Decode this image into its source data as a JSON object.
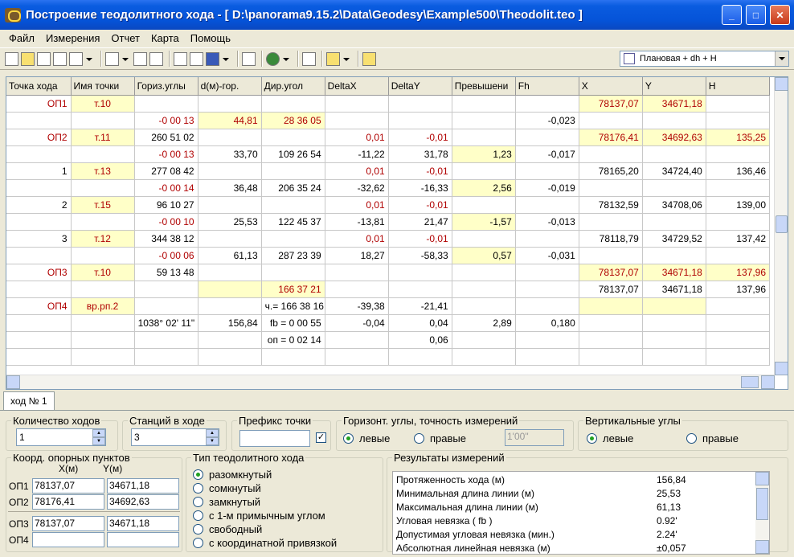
{
  "window": {
    "title": "Построение теодолитного хода - [ D:\\panorama9.15.2\\Data\\Geodesy\\Example500\\Theodolit.teo ]"
  },
  "menu": [
    "Файл",
    "Измерения",
    "Отчет",
    "Карта",
    "Помощь"
  ],
  "toolbar": {
    "mode_value": "Плановая + dh + H"
  },
  "grid": {
    "columns": [
      "Точка хода",
      "Имя точки",
      "Гориз.углы",
      "d(м)-гор.",
      "Дир.угол",
      "DeltaX",
      "DeltaY",
      "Превышени",
      "Fh",
      "X",
      "Y",
      "H"
    ],
    "rows": [
      [
        "ОП1",
        "т.10",
        "",
        "",
        "",
        "",
        "",
        "",
        "",
        "78137,07",
        "34671,18",
        ""
      ],
      [
        "",
        "",
        "-0 00 13",
        "44,81",
        "28 36 05",
        "",
        "",
        "",
        "-0,023",
        "",
        "",
        ""
      ],
      [
        "ОП2",
        "т.11",
        "260 51 02",
        "",
        "",
        "0,01",
        "-0,01",
        "",
        "",
        "78176,41",
        "34692,63",
        "135,25"
      ],
      [
        "",
        "",
        "-0 00 13",
        "33,70",
        "109 26 54",
        "-11,22",
        "31,78",
        "1,23",
        "-0,017",
        "",
        "",
        ""
      ],
      [
        "1",
        "т.13",
        "277 08 42",
        "",
        "",
        "0,01",
        "-0,01",
        "",
        "",
        "78165,20",
        "34724,40",
        "136,46"
      ],
      [
        "",
        "",
        "-0 00 14",
        "36,48",
        "206 35 24",
        "-32,62",
        "-16,33",
        "2,56",
        "-0,019",
        "",
        "",
        ""
      ],
      [
        "2",
        "т.15",
        "96 10 27",
        "",
        "",
        "0,01",
        "-0,01",
        "",
        "",
        "78132,59",
        "34708,06",
        "139,00"
      ],
      [
        "",
        "",
        "-0 00 10",
        "25,53",
        "122 45 37",
        "-13,81",
        "21,47",
        "-1,57",
        "-0,013",
        "",
        "",
        ""
      ],
      [
        "3",
        "т.12",
        "344 38 12",
        "",
        "",
        "0,01",
        "-0,01",
        "",
        "",
        "78118,79",
        "34729,52",
        "137,42"
      ],
      [
        "",
        "",
        "-0 00 06",
        "61,13",
        "287 23 39",
        "18,27",
        "-58,33",
        "0,57",
        "-0,031",
        "",
        "",
        ""
      ],
      [
        "ОП3",
        "т.10",
        "59 13 48",
        "",
        "",
        "",
        "",
        "",
        "",
        "78137,07",
        "34671,18",
        "137,96"
      ],
      [
        "",
        "",
        "",
        "",
        "166 37 21",
        "",
        "",
        "",
        "",
        "78137,07",
        "34671,18",
        "137,96"
      ],
      [
        "ОП4",
        "вр.рп.2",
        "",
        "",
        "ч.= 166 38 16",
        "-39,38",
        "-21,41",
        "",
        "",
        "",
        "",
        ""
      ],
      [
        "",
        "",
        "1038° 02' 11\"",
        "156,84",
        "fb =  0 00 55",
        "-0,04",
        "0,04",
        "2,89",
        "0,180",
        "",
        "",
        ""
      ],
      [
        "",
        "",
        "",
        "",
        "оп =  0 02 14",
        "",
        "0,06",
        "",
        "",
        "",
        "",
        ""
      ]
    ]
  },
  "tabs": [
    "ход № 1"
  ],
  "controls": {
    "count_label": "Количество ходов",
    "count_value": "1",
    "stations_label": "Станций в ходе",
    "stations_value": "3",
    "prefix_label": "Префикс точки",
    "prefix_value": "",
    "horiz_label": "Горизонт. углы, точность измерений",
    "horiz_left": "левые",
    "horiz_right": "правые",
    "precision": "1'00\"",
    "vert_label": "Вертикальные углы",
    "vert_left": "левые",
    "vert_right": "правые"
  },
  "coords": {
    "label": "Коорд. опорных пунктов",
    "x_label": "X(м)",
    "y_label": "Y(м)",
    "points": [
      {
        "name": "ОП1",
        "x": "78137,07",
        "y": "34671,18"
      },
      {
        "name": "ОП2",
        "x": "78176,41",
        "y": "34692,63"
      },
      {
        "name": "ОП3",
        "x": "78137,07",
        "y": "34671,18"
      },
      {
        "name": "ОП4",
        "x": "",
        "y": ""
      }
    ]
  },
  "traverse_type": {
    "label": "Тип теодолитного хода",
    "options": [
      "разомкнутый",
      "сомкнутый",
      "замкнутый",
      "с 1-м примычным углом",
      "свободный",
      "с координатной привязкой"
    ]
  },
  "results": {
    "label": "Результаты измерений",
    "rows": [
      {
        "name": "Протяженность хода (м)",
        "value": "156,84"
      },
      {
        "name": "Минимальная длина линии (м)",
        "value": "25,53"
      },
      {
        "name": "Максимальная длина линии (м)",
        "value": "61,13"
      },
      {
        "name": "Угловая невязка ( fb )",
        "value": "0.92'"
      },
      {
        "name": "Допустимая угловая невязка (мин.)",
        "value": "2.24'"
      },
      {
        "name": "Абсолютная линейная невязка (м)",
        "value": "±0,057"
      }
    ]
  }
}
